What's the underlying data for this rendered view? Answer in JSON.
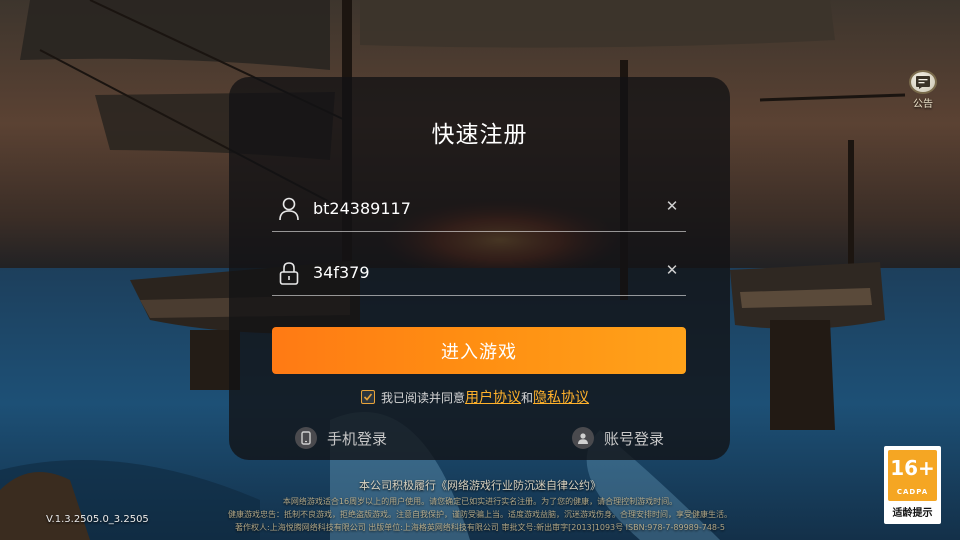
{
  "announcement": {
    "label": "公告",
    "icon": "announcement-icon"
  },
  "dialog": {
    "title": "快速注册",
    "username": {
      "value": "bt24389117",
      "icon": "user-icon",
      "clear_icon": "close-icon"
    },
    "password": {
      "value": "34f379",
      "icon": "lock-icon",
      "clear_icon": "close-icon"
    },
    "enter_button": "进入游戏",
    "agreement": {
      "checked": true,
      "prefix": "我已阅读并同意",
      "user_agreement": "用户协议",
      "connector": "和",
      "privacy_policy": "隐私协议"
    },
    "phone_login": "手机登录",
    "account_login": "账号登录"
  },
  "footer": {
    "line1": "本公司积极履行《网络游戏行业防沉迷自律公约》",
    "line2": "本网络游戏适合16周岁以上的用户使用。请您确定已如实进行实名注册。为了您的健康，请合理控制游戏时间。",
    "line3": "健康游戏忠告：抵制不良游戏，拒绝盗版游戏。注意自我保护，谨防受骗上当。适度游戏益脑，沉迷游戏伤身。合理安排时间，享受健康生活。",
    "line4": "著作权人:上海悦腾网络科技有限公司 出版单位:上海格英网络科技有限公司 审批文号:新出审字[2013]1093号 ISBN:978-7-89989-748-5",
    "version": "V.1.3.2505.0_3.2505"
  },
  "age_rating": {
    "number": "16+",
    "org": "CADPA",
    "tip": "适龄提示"
  },
  "colors": {
    "accent_orange": "#ff8f12",
    "link": "#ffb12b",
    "badge_orange": "#f5a623"
  }
}
